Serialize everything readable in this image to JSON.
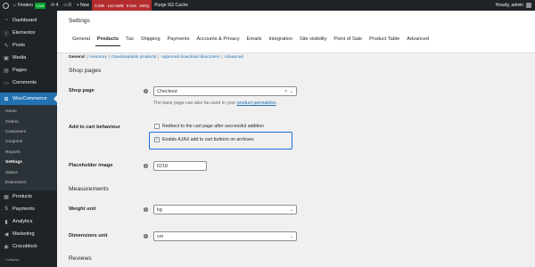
{
  "adminbar": {
    "site_name": "Findero",
    "live_label": "Live",
    "updates_count": "4",
    "comments_count": "0",
    "new_label": "+ New",
    "perf_stats": [
      "0.39s",
      "142.5MB",
      "0.04s",
      "192Q"
    ],
    "purge_label": "Purge SG Cache",
    "greeting": "Howdy, admin"
  },
  "sidebar": {
    "items": [
      {
        "label": "Dashboard",
        "icon": "dashboard-icon"
      },
      {
        "label": "Elementor",
        "icon": "elementor-icon"
      },
      {
        "label": "Posts",
        "icon": "pin-icon"
      },
      {
        "label": "Media",
        "icon": "media-icon"
      },
      {
        "label": "Pages",
        "icon": "page-icon"
      },
      {
        "label": "Comments",
        "icon": "comment-icon"
      }
    ],
    "active_item": {
      "label": "WooCommerce",
      "icon": "woocommerce-icon"
    },
    "submenu": [
      "Home",
      "Orders",
      "Customers",
      "Coupons",
      "Reports",
      "Settings",
      "Status",
      "Extensions"
    ],
    "current_submenu": "Settings",
    "items_after": [
      {
        "label": "Products",
        "icon": "products-icon"
      },
      {
        "label": "Payments",
        "icon": "payments-icon"
      },
      {
        "label": "Analytics",
        "icon": "analytics-icon"
      },
      {
        "label": "Marketing",
        "icon": "marketing-icon"
      },
      {
        "label": "Crocoblock",
        "icon": "crocoblock-icon"
      }
    ],
    "collapse_label": "Collapse"
  },
  "page": {
    "heading": "Settings",
    "tabs": [
      "General",
      "Products",
      "Tax",
      "Shipping",
      "Payments",
      "Accounts & Privacy",
      "Emails",
      "Integration",
      "Site visibility",
      "Point of Sale",
      "Product Table",
      "Advanced"
    ],
    "active_tab": "Products",
    "subnav": [
      "General",
      "Inventory",
      "Downloadable products",
      "Approved download directories",
      "Advanced"
    ]
  },
  "shop_pages": {
    "title": "Shop pages",
    "shop_page_label": "Shop page",
    "shop_page_value": "Checkout",
    "shop_page_desc_prefix": "The base page can also be used in your ",
    "shop_page_desc_link": "product permalinks",
    "shop_page_desc_suffix": ".",
    "add_to_cart_label": "Add to cart behaviour",
    "redirect_label": "Redirect to the cart page after successful addition",
    "redirect_checked": false,
    "ajax_label": "Enable AJAX add to cart buttons on archives",
    "ajax_checked": true,
    "placeholder_label": "Placeholder image",
    "placeholder_value": "6218"
  },
  "measurements": {
    "title": "Measurements",
    "weight_label": "Weight unit",
    "weight_value": "kg",
    "dimensions_label": "Dimensions unit",
    "dimensions_value": "cm"
  },
  "reviews": {
    "title": "Reviews"
  },
  "colors": {
    "accent": "#2271b1",
    "highlight": "#1a6de0",
    "sidebar_bg": "#1d2327",
    "perf_bg": "#b32d2e",
    "live_badge": "#00a32a"
  }
}
